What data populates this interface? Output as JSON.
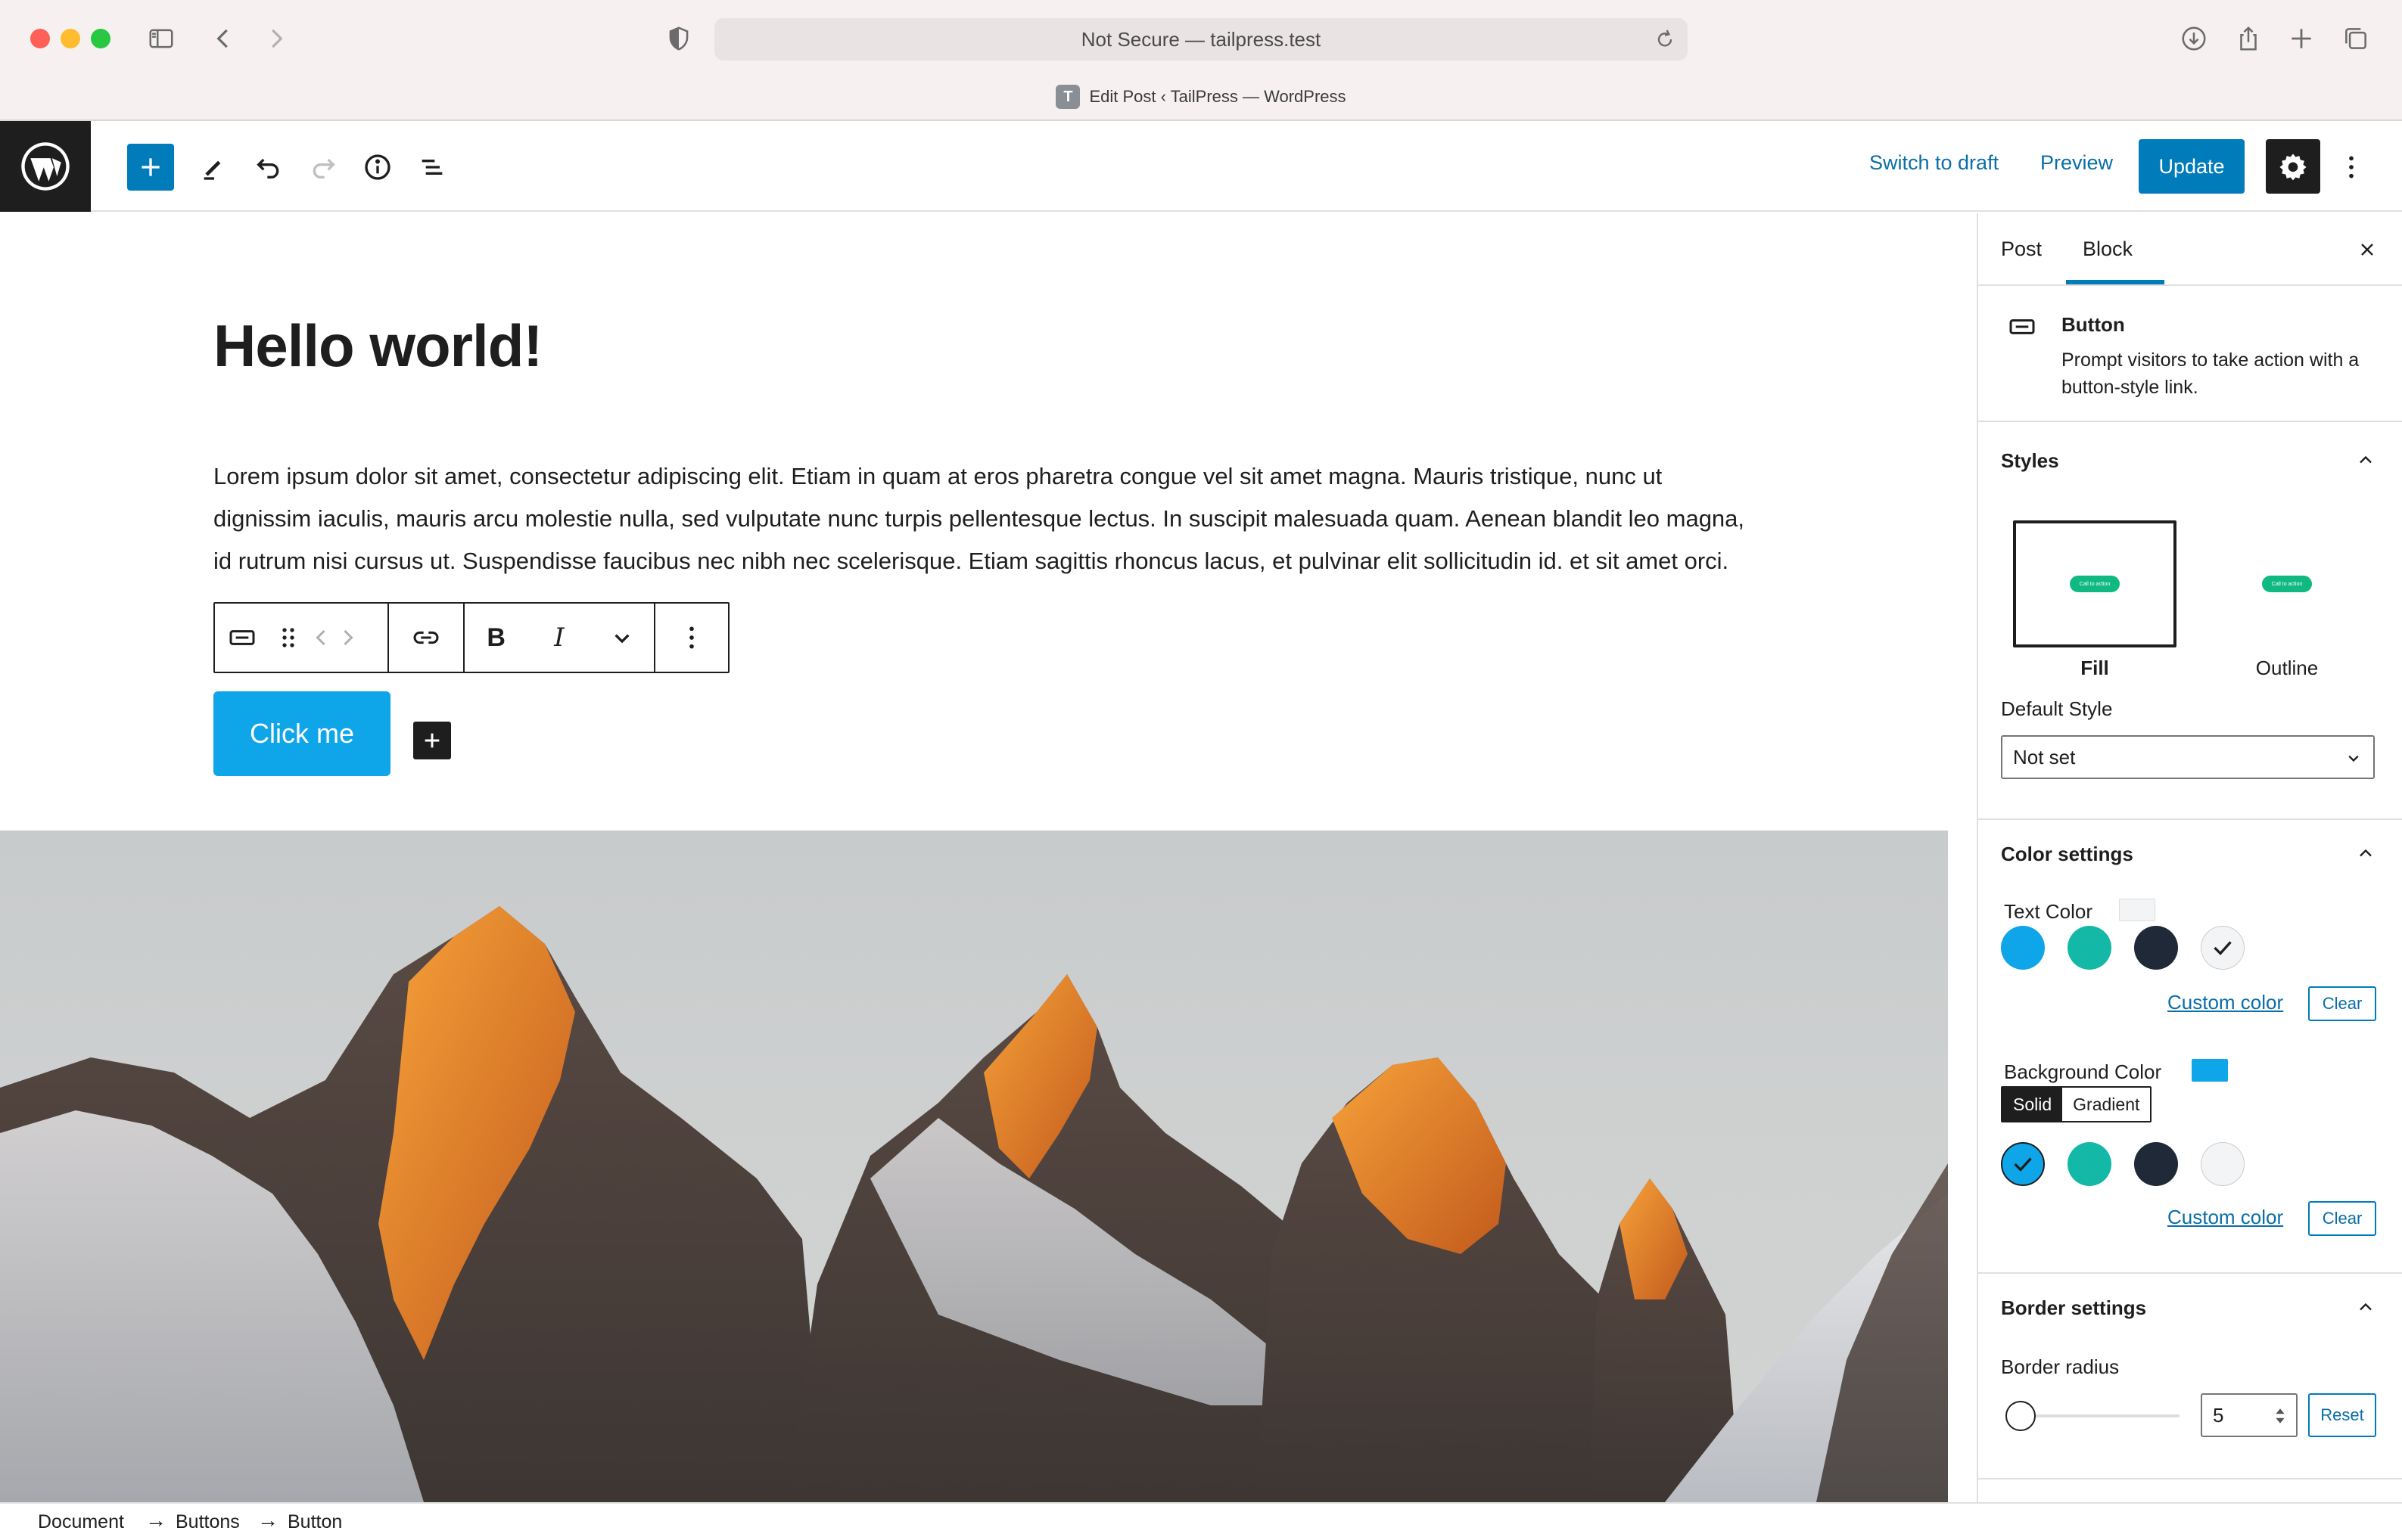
{
  "browser": {
    "url_text": "Not Secure — tailpress.test",
    "tab_favicon_letter": "T",
    "tab_title": "Edit Post ‹ TailPress — WordPress"
  },
  "header": {
    "switch_to_draft": "Switch to draft",
    "preview": "Preview",
    "update": "Update"
  },
  "editor": {
    "title": "Hello world!",
    "paragraph": "Lorem ipsum dolor sit amet, consectetur adipiscing elit. Etiam in quam at eros pharetra congue vel sit amet magna. Mauris tristique, nunc ut dignissim iaculis, mauris arcu molestie nulla, sed vulputate nunc turpis pellentesque lectus. In suscipit malesuada quam. Aenean blandit leo magna, id rutrum nisi cursus ut. Suspendisse faucibus nec nibh nec scelerisque. Etiam sagittis rhoncus lacus, et pulvinar elit sollicitudin id. ",
    "paragraph_tail": "et sit amet orci.",
    "button_text": "Click me",
    "toolbar": {
      "bold": "B",
      "italic": "I"
    }
  },
  "breadcrumb": [
    "Document",
    "Buttons",
    "Button"
  ],
  "sidebar": {
    "tabs": [
      "Post",
      "Block"
    ],
    "active_tab": "Block",
    "block": {
      "title": "Button",
      "description": "Prompt visitors to take action with a button-style link."
    },
    "styles": {
      "title": "Styles",
      "options": [
        "Fill",
        "Outline"
      ],
      "preview_text": "Call to action",
      "selected": "Fill",
      "default_style_label": "Default Style",
      "default_style_value": "Not set"
    },
    "color_settings": {
      "title": "Color settings",
      "text_color_label": "Text Color",
      "background_color_label": "Background Color",
      "custom_color": "Custom color",
      "clear": "Clear",
      "tabs": [
        "Solid",
        "Gradient"
      ],
      "active_tab": "Solid",
      "palette": [
        "#0ea5e9",
        "#14b8a6",
        "#1f2937",
        "#f3f4f6"
      ],
      "text_color_selected": "#f3f4f6",
      "background_color_selected": "#0ea5e9"
    },
    "border_settings": {
      "title": "Border settings",
      "radius_label": "Border radius",
      "radius_value": "5",
      "reset": "Reset"
    }
  }
}
